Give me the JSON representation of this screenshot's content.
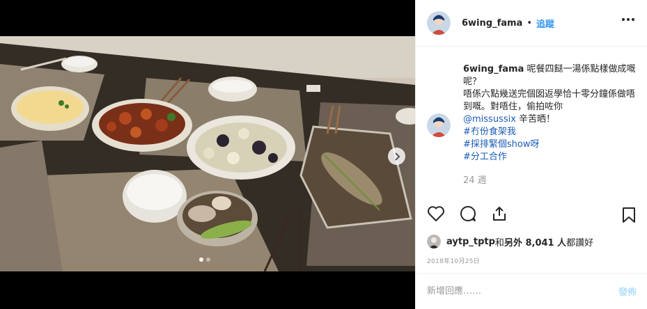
{
  "post": {
    "username": "6wing_fama",
    "separator": "•",
    "follow_label": "追蹤"
  },
  "caption": {
    "username": "6wing_fama",
    "line1": " 呢餐四餸一湯係點樣做成嘅呢？",
    "line2": "唔係六點幾送完個囡返學恰十零分鐘係做唔到嘅。對唔住，偷拍咗你",
    "mention": "@missussix",
    "after_mention": " 辛苦晒！",
    "hashtags": [
      "#冇份食架我",
      "#採排緊個show呀",
      "#分工合作"
    ]
  },
  "comment_age": "24 週",
  "likes": {
    "liker": "aytp_tptp",
    "connector": " 和 ",
    "others": "另外 8,041 人",
    "suffix": " 都讚好"
  },
  "post_date": "2018年10月25日",
  "comment_bar": {
    "placeholder": "新增回應……",
    "post_label": "發佈"
  },
  "carousel": {
    "slides": 2,
    "active": 1
  },
  "icons": {
    "like": "heart-icon",
    "comment": "comment-bubble-icon",
    "share": "share-icon",
    "save": "bookmark-icon",
    "more": "more-options-icon",
    "next": "chevron-right-icon"
  }
}
